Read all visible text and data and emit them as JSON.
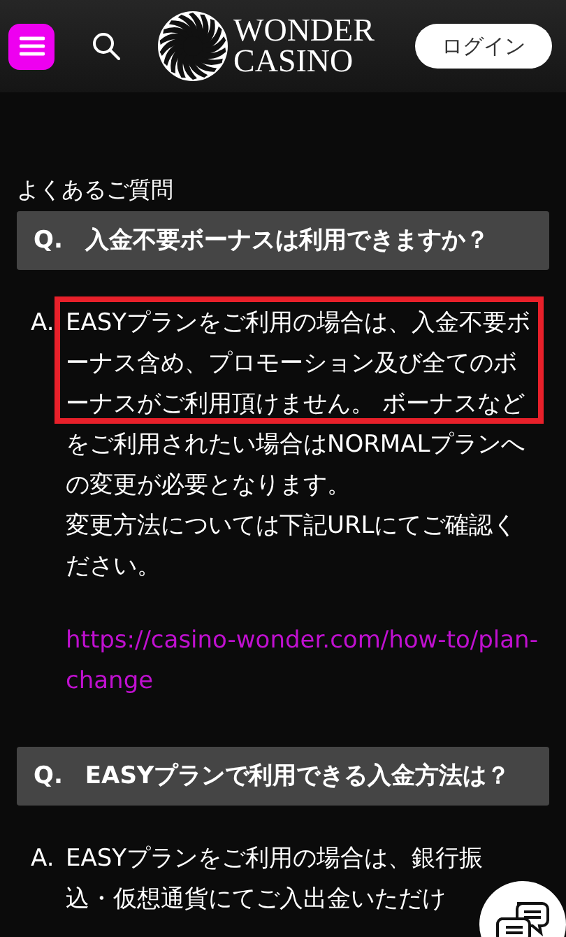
{
  "header": {
    "brand_line_1": "WONDER",
    "brand_line_2": "CASINO",
    "login": "ログイン"
  },
  "section_title": "よくあるご質問",
  "faq": [
    {
      "q_mark": "Q.",
      "question": "入金不要ボーナスは利用できますか？",
      "a_mark": "A.",
      "answer": [
        "EASYプランをご利用の場合は、入金不要ボーナス含め、プロモーション及び全てのボーナスがご利用頂けません。 ボーナスなどをご利用されたい場合はNORMALプランへの変更が必要となります。",
        "変更方法については下記URLにてご確認ください。"
      ],
      "link": "https://casino-wonder.com/how-to/plan-change",
      "highlighted": true
    },
    {
      "q_mark": "Q.",
      "question": "EASYプランで利用できる入金方法は？",
      "a_mark": "A.",
      "answer": [
        "EASYプランをご利用の場合は、銀行振",
        "込・仮想通貨にてご入出金いただけ"
      ],
      "highlighted": false
    }
  ]
}
